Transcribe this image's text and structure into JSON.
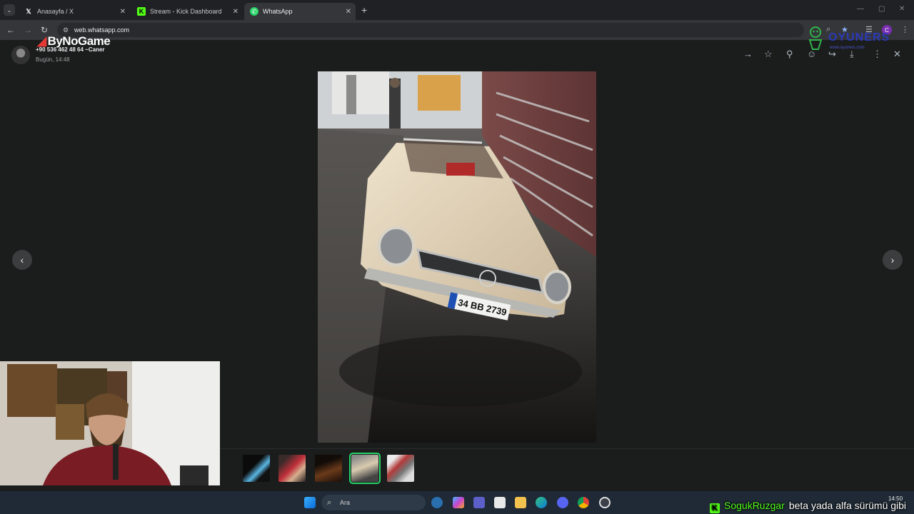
{
  "browser": {
    "tabs": [
      {
        "title": "Anasayfa / X",
        "icon": "x-logo-icon"
      },
      {
        "title": "Stream - Kick Dashboard",
        "icon": "kick-logo-icon"
      },
      {
        "title": "WhatsApp",
        "icon": "whatsapp-logo-icon",
        "active": true
      }
    ],
    "url": "web.whatsapp.com",
    "profile_initial": "C"
  },
  "viewer": {
    "brand": "ByNoGame",
    "sender": "+90 536 462 48 64 ~Caner",
    "timestamp": "Bugün, 14:48",
    "image_plate": "34 BB 2739",
    "thumbnail_count": 5,
    "selected_thumbnail_index": 3
  },
  "watermark": {
    "text": "OYUNERS",
    "sub": "www.oyuners.com"
  },
  "taskbar": {
    "search_placeholder": "Ara",
    "time": "14:50"
  },
  "chat_overlay": {
    "username": "SogukRuzgar",
    "message": "beta yada alfa sürümü gibi"
  },
  "colors": {
    "accent": "#25d366",
    "kick_green": "#53fc18",
    "viewer_bg": "#1b1c1c"
  }
}
